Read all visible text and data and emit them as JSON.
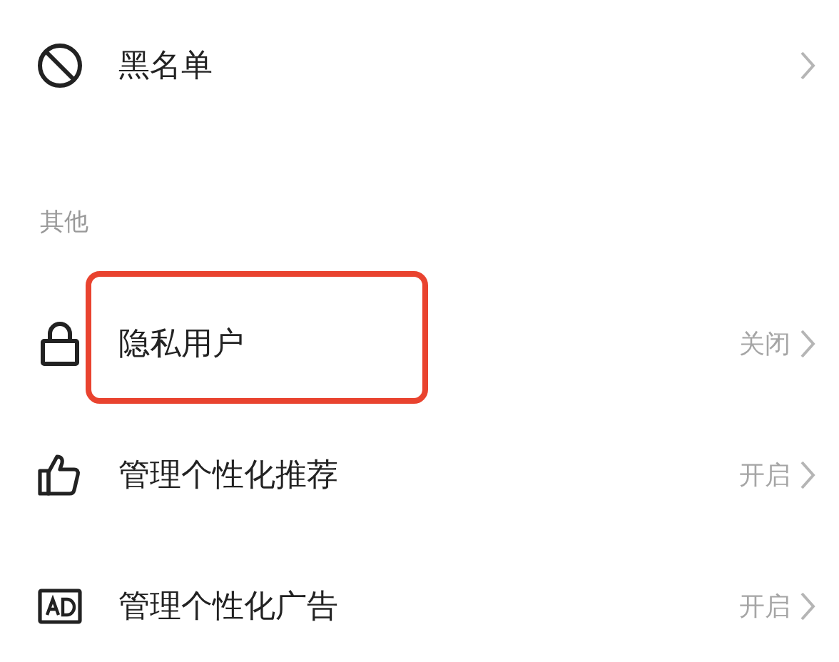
{
  "items": [
    {
      "kind": "row",
      "label": "黑名单",
      "value": ""
    },
    {
      "kind": "header",
      "label": "其他"
    },
    {
      "kind": "row",
      "label": "隐私用户",
      "value": "关闭",
      "highlighted": true
    },
    {
      "kind": "row",
      "label": "管理个性化推荐",
      "value": "开启"
    },
    {
      "kind": "row",
      "label": "管理个性化广告",
      "value": "开启"
    }
  ]
}
